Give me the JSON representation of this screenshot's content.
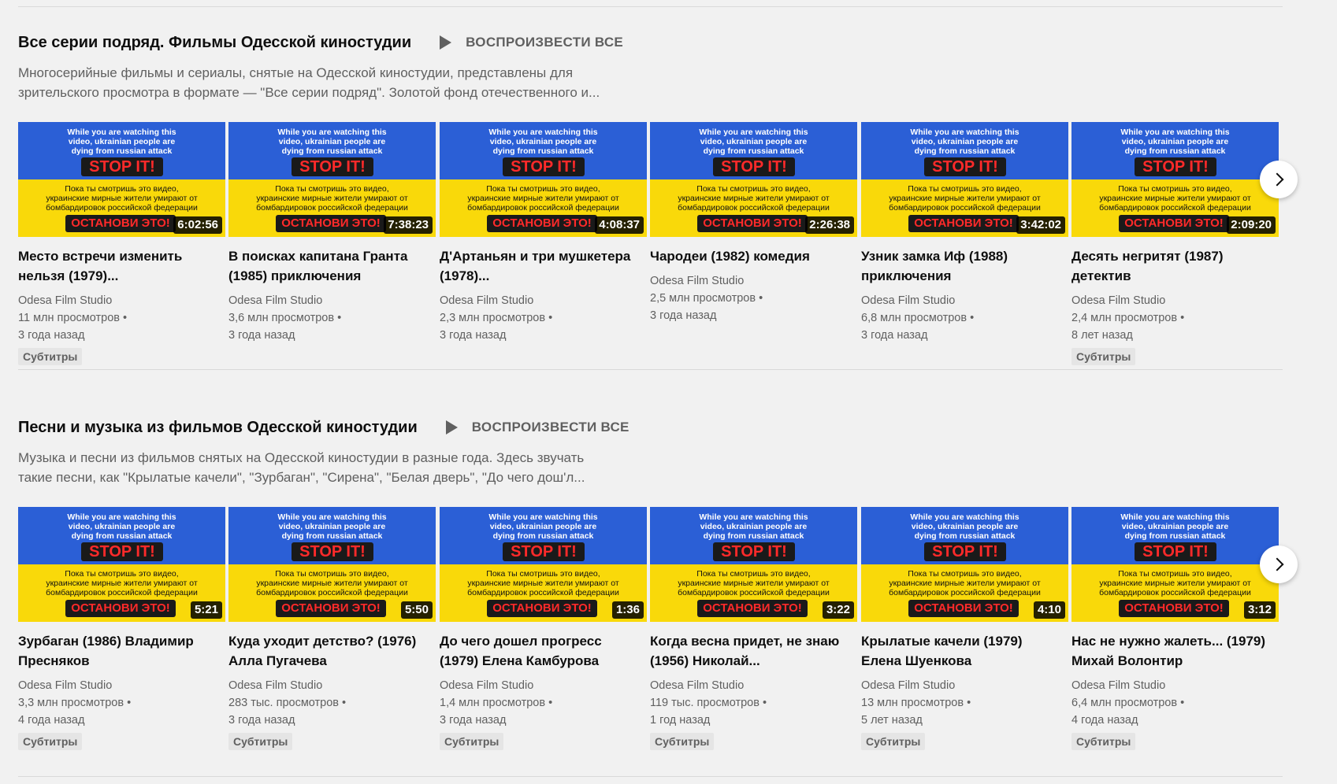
{
  "thumb_text": {
    "en_line1": "While you are watching this",
    "en_line2": "video, ukrainian people are",
    "en_line3": "dying from russian attack",
    "stop": "STOP IT!",
    "ru_line1": "Пока ты смотришь это видео,",
    "ru_line2": "украинские мирные жители умирают от",
    "ru_line3": "бомбардировок российской федерации",
    "ostanovi": "ОСТАНОВИ ЭТО!"
  },
  "shelves": [
    {
      "title": "Все серии подряд. Фильмы Одесской киностудии",
      "play_all": "ВОСПРОИЗВЕСТИ ВСЕ",
      "desc_line1": "Многосерийные фильмы и сериалы, снятые на Одесской киностудии, представлены для",
      "desc_line2": "зрительского просмотра в формате — \"Все серии подряд\". Золотой фонд отечественного и...",
      "videos": [
        {
          "title": "Место встречи изменить нельзя (1979)...",
          "channel": "Odesa Film Studio",
          "views": "11 млн просмотров •",
          "age": "3 года назад",
          "badge": "Субтитры",
          "duration": "6:02:56"
        },
        {
          "title": "В поисках капитана Гранта (1985) приключения",
          "channel": "Odesa Film Studio",
          "views": "3,6 млн просмотров •",
          "age": "3 года назад",
          "badge": "",
          "duration": "7:38:23"
        },
        {
          "title": "Д'Артаньян и три мушкетера (1978)...",
          "channel": "Odesa Film Studio",
          "views": "2,3 млн просмотров •",
          "age": "3 года назад",
          "badge": "",
          "duration": "4:08:37"
        },
        {
          "title": "Чародеи (1982) комедия",
          "channel": "Odesa Film Studio",
          "views": "2,5 млн просмотров •",
          "age": "3 года назад",
          "badge": "",
          "duration": "2:26:38"
        },
        {
          "title": "Узник замка Иф (1988) приключения",
          "channel": "Odesa Film Studio",
          "views": "6,8 млн просмотров •",
          "age": "3 года назад",
          "badge": "",
          "duration": "3:42:02"
        },
        {
          "title": "Десять негритят (1987) детектив",
          "channel": "Odesa Film Studio",
          "views": "2,4 млн просмотров •",
          "age": "8 лет назад",
          "badge": "Субтитры",
          "duration": "2:09:20"
        }
      ]
    },
    {
      "title": "Песни и музыка из фильмов Одесской киностудии",
      "play_all": "ВОСПРОИЗВЕСТИ ВСЕ",
      "desc_line1": "Музыка и песни из фильмов снятых на Одесской киностудии в разные года. Здесь звучать",
      "desc_line2": "такие песни, как \"Крылатые качели\", \"Зурбаган\", \"Сирена\", \"Белая дверь\", \"До чего дош'л...",
      "videos": [
        {
          "title": "Зурбаган (1986) Владимир Пресняков",
          "channel": "Odesa Film Studio",
          "views": "3,3 млн просмотров •",
          "age": "4 года назад",
          "badge": "Субтитры",
          "duration": "5:21"
        },
        {
          "title": "Куда уходит детство? (1976) Алла Пугачева",
          "channel": "Odesa Film Studio",
          "views": "283 тыс. просмотров •",
          "age": "3 года назад",
          "badge": "Субтитры",
          "duration": "5:50"
        },
        {
          "title": "До чего дошел прогресс (1979) Елена Камбурова",
          "channel": "Odesa Film Studio",
          "views": "1,4 млн просмотров •",
          "age": "3 года назад",
          "badge": "Субтитры",
          "duration": "1:36"
        },
        {
          "title": "Когда весна придет, не знаю (1956) Николай...",
          "channel": "Odesa Film Studio",
          "views": "119 тыс. просмотров •",
          "age": "1 год назад",
          "badge": "Субтитры",
          "duration": "3:22"
        },
        {
          "title": "Крылатые качели (1979) Елена Шуенкова",
          "channel": "Odesa Film Studio",
          "views": "13 млн просмотров •",
          "age": "5 лет назад",
          "badge": "Субтитры",
          "duration": "4:10"
        },
        {
          "title": "Нас не нужно жалеть... (1979) Михай Волонтир",
          "channel": "Odesa Film Studio",
          "views": "6,4 млн просмотров •",
          "age": "4 года назад",
          "badge": "Субтитры",
          "duration": "3:12"
        }
      ]
    }
  ]
}
